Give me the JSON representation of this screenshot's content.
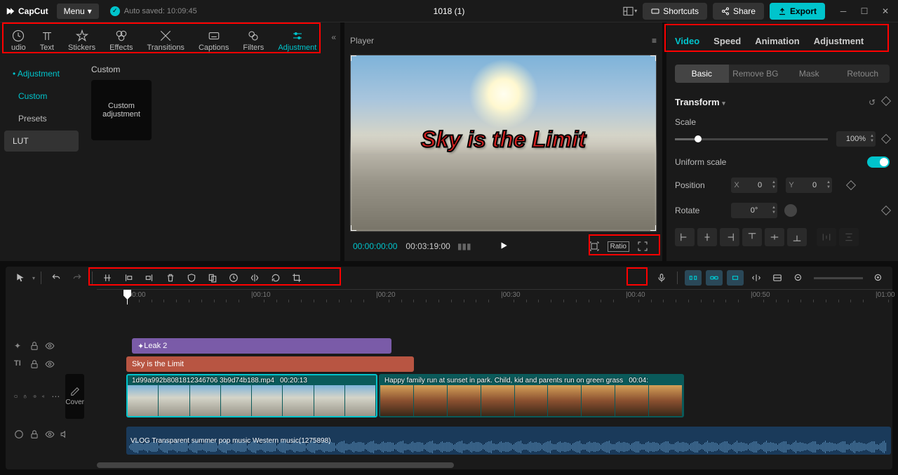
{
  "app_name": "CapCut",
  "menu_label": "Menu",
  "autosave": "Auto saved: 10:09:45",
  "project_title": "1018 (1)",
  "top_buttons": {
    "shortcuts": "Shortcuts",
    "share": "Share",
    "export": "Export"
  },
  "tool_tabs": [
    "udio",
    "Text",
    "Stickers",
    "Effects",
    "Transitions",
    "Captions",
    "Filters",
    "Adjustment"
  ],
  "tool_tabs_active": 7,
  "sidebar": {
    "items": [
      "Adjustment",
      "Custom",
      "Presets",
      "LUT"
    ],
    "active": 0,
    "secondary_active": 1
  },
  "content": {
    "section_title": "Custom",
    "thumb_label": "Custom adjustment"
  },
  "player": {
    "title": "Player",
    "overlay_text": "Sky is the Limit",
    "time_current": "00:00:00:00",
    "time_total": "00:03:19:00",
    "ratio_label": "Ratio"
  },
  "inspector": {
    "tabs": [
      "Video",
      "Speed",
      "Animation",
      "Adjustment"
    ],
    "active": 0,
    "subtabs": [
      "Basic",
      "Remove BG",
      "Mask",
      "Retouch"
    ],
    "subtab_active": 0,
    "section_title": "Transform",
    "rows": {
      "scale_label": "Scale",
      "scale_value": "100%",
      "uniform_label": "Uniform scale",
      "position_label": "Position",
      "pos_x": "0",
      "pos_y": "0",
      "rotate_label": "Rotate",
      "rotate_value": "0°"
    }
  },
  "timeline": {
    "ruler": [
      "00:00",
      "00:10",
      "00:20",
      "00:30",
      "00:40",
      "00:50",
      "01:00"
    ],
    "effect_clip": "Leak 2",
    "text_clip": "Sky is the Limit",
    "video1_name": "1d99a992b8081812346706 3b9d74b188.mp4",
    "video1_time": "00:20:13",
    "video2_name": "Happy family run at sunset in park. Child, kid and parents run on green grass",
    "video2_time": "00:04:",
    "audio_name": "VLOG Transparent summer pop music Western music(1275898)",
    "cover_label": "Cover"
  }
}
